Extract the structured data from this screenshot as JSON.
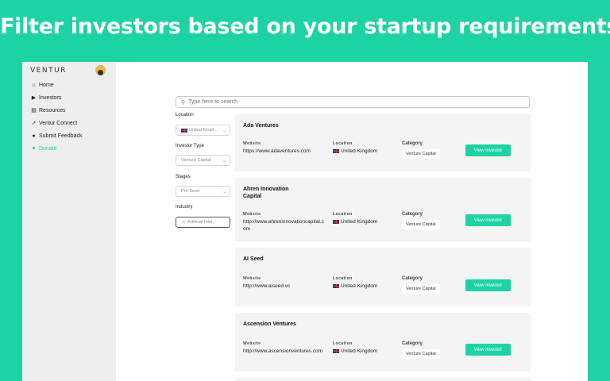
{
  "headline": "Filter investors based on your startup requirements.",
  "app": {
    "logo": "VENTUR",
    "nav": [
      {
        "label": "Home",
        "icon": "home-icon"
      },
      {
        "label": "Investors",
        "icon": "play-icon"
      },
      {
        "label": "Resources",
        "icon": "book-icon"
      },
      {
        "label": "Ventur Connect",
        "icon": "rocket-icon"
      },
      {
        "label": "Submit Feedback",
        "icon": "chat-icon"
      },
      {
        "label": "Donate",
        "icon": "heart-icon",
        "active": true
      }
    ]
  },
  "search": {
    "placeholder": "Type here to search"
  },
  "filters": {
    "location": {
      "label": "Location",
      "value": "United Kingd..."
    },
    "investor_type": {
      "label": "Investor Type",
      "value": "Venture Capital"
    },
    "stages": {
      "label": "Stages",
      "value": "Pre-Seed"
    },
    "industry": {
      "label": "Industry",
      "value": "Artificial Intel..."
    }
  },
  "columns": {
    "website": "Website",
    "location": "Location",
    "category": "Category"
  },
  "button_label": "View investor",
  "investors": [
    {
      "name": "Ada Ventures",
      "website": "https://www.adaventures.com",
      "location": "United Kingdom",
      "category": "Venture Capital"
    },
    {
      "name": "Ahren Innovation Capital",
      "website": "http://www.ahreninnovationcapital.com",
      "location": "United Kingdom",
      "category": "Venture Capital"
    },
    {
      "name": "AI Seed",
      "website": "http://www.aiseed.vc",
      "location": "United Kingdom",
      "category": "Venture Capital"
    },
    {
      "name": "Ascension Ventures",
      "website": "http://www.ascensionventures.com",
      "location": "United Kingdom",
      "category": "Venture Capital"
    }
  ],
  "colors": {
    "accent": "#1ed3a3",
    "sidebar": "#eeeeee",
    "card": "#f4f4f4"
  }
}
